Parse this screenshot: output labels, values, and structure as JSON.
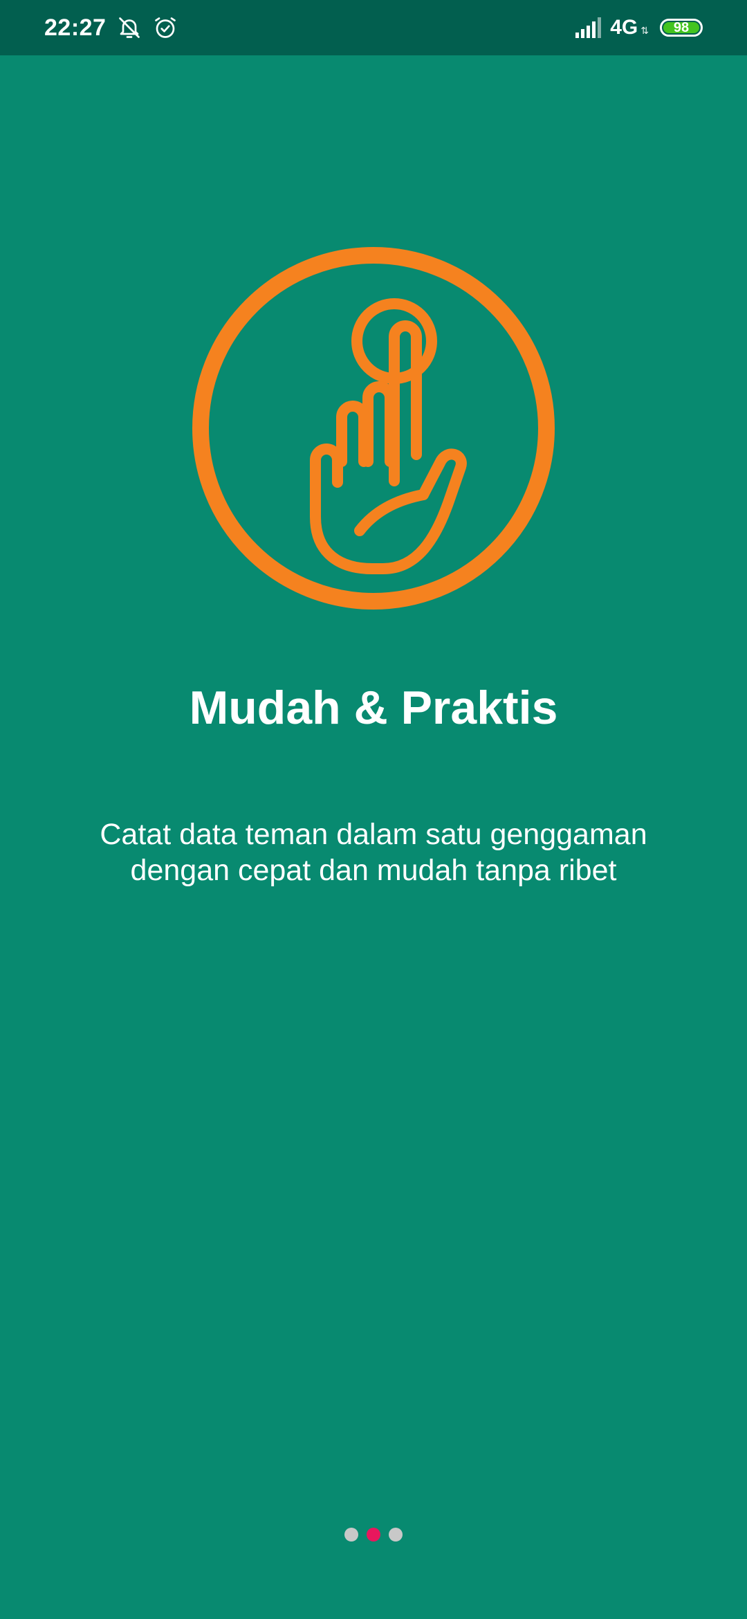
{
  "status_bar": {
    "time": "22:27",
    "network": "4G",
    "battery": "98",
    "battery_level": 0.98
  },
  "onboarding": {
    "title": "Mudah & Praktis",
    "description": "Catat data teman dalam satu genggaman dengan cepat dan mudah tanpa ribet",
    "illustration_icon": "tap-hand-icon",
    "pager": {
      "count": 3,
      "active_index": 1
    }
  },
  "colors": {
    "background": "#088a70",
    "status_bar": "#025f4f",
    "accent_orange": "#f5821f",
    "text": "#ffffff",
    "dot_active": "#e8175d",
    "dot_inactive": "#c8c8c8",
    "battery_fill": "#43c41f"
  }
}
